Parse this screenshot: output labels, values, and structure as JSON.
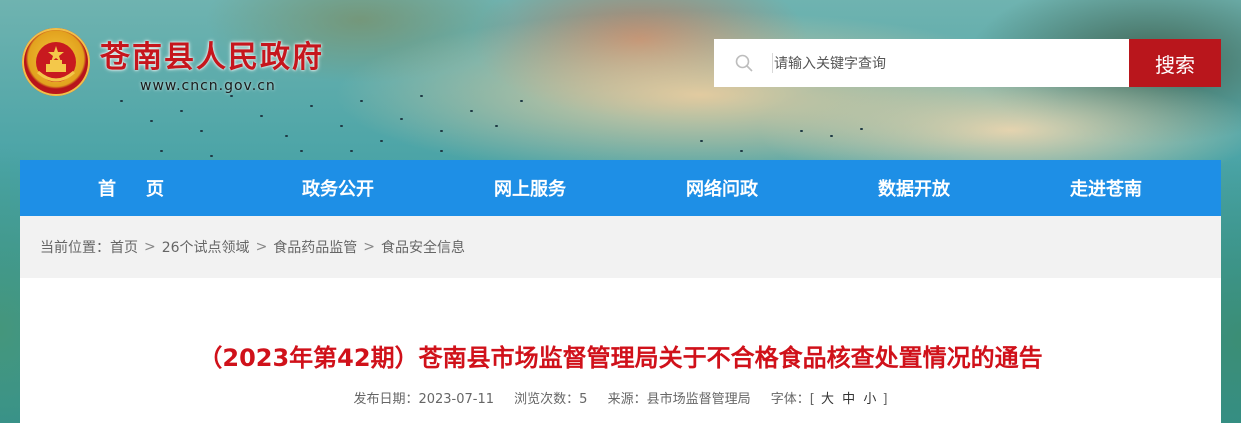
{
  "header": {
    "site_title": "苍南县人民政府",
    "site_url": "www.cncn.gov.cn",
    "emblem_icon": "national-emblem-icon"
  },
  "search": {
    "placeholder": "请输入关键字查询",
    "button_label": "搜索",
    "icon": "search-icon"
  },
  "nav": {
    "items": [
      {
        "label": "首页"
      },
      {
        "label": "政务公开"
      },
      {
        "label": "网上服务"
      },
      {
        "label": "网络问政"
      },
      {
        "label": "数据开放"
      },
      {
        "label": "走进苍南"
      }
    ]
  },
  "breadcrumb": {
    "prefix": "当前位置：",
    "items": [
      "首页",
      "26个试点领域",
      "食品药品监管",
      "食品安全信息"
    ],
    "separator": ">"
  },
  "article": {
    "title": "（2023年第42期）苍南县市场监督管理局关于不合格食品核查处置情况的通告",
    "publish_label": "发布日期：",
    "publish_date": "2023-07-11",
    "views_label": "浏览次数：",
    "views": "5",
    "source_label": "来源：",
    "source": "县市场监督管理局",
    "font_label": "字体：",
    "font_open": "[",
    "font_large": "大",
    "font_medium": "中",
    "font_small": "小",
    "font_close": "]"
  },
  "colors": {
    "brand_red": "#c6161d",
    "nav_blue": "#1e8fe6",
    "search_red": "#b9161c",
    "title_red": "#d0111a"
  }
}
